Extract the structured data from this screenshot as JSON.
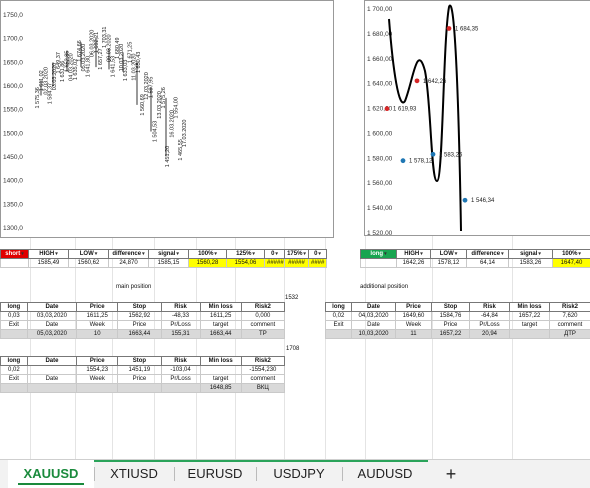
{
  "chart_left": {
    "y_ticks": [
      "1750,0",
      "1700,0",
      "1650,0",
      "1600,0",
      "1550,0",
      "1500,0",
      "1450,0",
      "1400,0",
      "1350,0",
      "1300,0"
    ],
    "y_values": [
      1750,
      1700,
      1650,
      1600,
      1550,
      1500,
      1450,
      1400,
      1350,
      1300
    ],
    "rotated_labels": [
      {
        "text": "1 575,36",
        "v": 1575
      },
      {
        "text": "1 611,02",
        "v": 1611
      },
      {
        "text": "02.03.2020",
        "v": 1611
      },
      {
        "text": "1 584,37",
        "v": 1584
      },
      {
        "text": "03.03.2020",
        "v": 1620
      },
      {
        "text": "1 649,37",
        "v": 1649
      },
      {
        "text": "1 631,86",
        "v": 1631
      },
      {
        "text": "1 652,85",
        "v": 1652
      },
      {
        "text": "04.03.2020",
        "v": 1640
      },
      {
        "text": "1 635,02",
        "v": 1635
      },
      {
        "text": "1 674,66",
        "v": 1674
      },
      {
        "text": "05.03.2020",
        "v": 1660
      },
      {
        "text": "1 641,80",
        "v": 1641
      },
      {
        "text": "06.03.2020",
        "v": 1690
      },
      {
        "text": "1 692,21",
        "v": 1692
      },
      {
        "text": "1 657,27",
        "v": 1657
      },
      {
        "text": "1 703,31",
        "v": 1703
      },
      {
        "text": "09.03.2020",
        "v": 1680
      },
      {
        "text": "1 641,53",
        "v": 1641
      },
      {
        "text": "1 680,49",
        "v": 1680
      },
      {
        "text": "10.03.2020",
        "v": 1660
      },
      {
        "text": "1 633,03",
        "v": 1633
      },
      {
        "text": "1 671,25",
        "v": 1671
      },
      {
        "text": "11.03.2020",
        "v": 1640
      },
      {
        "text": "1 650,43",
        "v": 1650
      },
      {
        "text": "1 560,69",
        "v": 1560
      },
      {
        "text": "12.03.2020",
        "v": 1600
      },
      {
        "text": "1 597,95",
        "v": 1597
      },
      {
        "text": "1 504,53",
        "v": 1504
      },
      {
        "text": "13.03.2020",
        "v": 1560
      },
      {
        "text": "1 575,26",
        "v": 1575
      },
      {
        "text": "1 451,20",
        "v": 1451
      },
      {
        "text": "16.03.2020",
        "v": 1520
      },
      {
        "text": "1 554,00",
        "v": 1554
      },
      {
        "text": "1 465,55",
        "v": 1465
      },
      {
        "text": "17.03.2020",
        "v": 1500
      }
    ]
  },
  "chart_right": {
    "y_ticks": [
      "1 700,00",
      "1 680,00",
      "1 660,00",
      "1 640,00",
      "1 620,00",
      "1 600,00",
      "1 580,00",
      "1 560,00",
      "1 540,00",
      "1 520,00"
    ],
    "y_values": [
      1700,
      1680,
      1660,
      1640,
      1620,
      1600,
      1580,
      1560,
      1540,
      1520
    ],
    "points": [
      {
        "label": "1 619,93",
        "y": 1619.93,
        "color": "#d62728"
      },
      {
        "label": "1 642,26",
        "y": 1642.26,
        "color": "#d62728"
      },
      {
        "label": "1 684,35",
        "y": 1684.35,
        "color": "#d62728"
      },
      {
        "label": "1 578,12",
        "y": 1578.12,
        "color": "#1f77b4"
      },
      {
        "label": "1 583,26",
        "y": 1583.26,
        "color": "#1f77b4"
      },
      {
        "label": "1 546,34",
        "y": 1546.34,
        "color": "#1f77b4"
      }
    ]
  },
  "left_block": {
    "header": {
      "c1": "short",
      "c2": "HIGH",
      "c3": "LOW",
      "c4": "difference",
      "c5": "signal",
      "c6": "100%",
      "c7": "125%",
      "c8": "0",
      "c9": "175%",
      "c10": "0"
    },
    "row": {
      "c2": "1585,49",
      "c3": "1560,62",
      "c4": "24,870",
      "c5": "1585,15",
      "c6": "1560,28",
      "c7": "1554,06",
      "c8": "#####",
      "c9": "#####",
      "c10": "####"
    },
    "main_position_label": "main position",
    "floating_value": "1532",
    "trade": {
      "hdr": [
        "long",
        "Date",
        "Price",
        "Stop",
        "Risk",
        "Min loss",
        "Risk2"
      ],
      "r1": [
        "0,03",
        "03,03,2020",
        "1611,25",
        "1562,92",
        "-48,33",
        "1611,25",
        "0,000"
      ],
      "r2": [
        "Exit",
        "Date",
        "Week",
        "Price",
        "Pr/Loss",
        "target",
        "comment"
      ],
      "r3": [
        "",
        "05,03,2020",
        "10",
        "1663,44",
        "155,31",
        "1663,44",
        "TP"
      ]
    },
    "floating_value2": "1708",
    "trade2": {
      "hdr": [
        "long",
        "Date",
        "Price",
        "Stop",
        "Risk",
        "Min loss",
        "Risk2"
      ],
      "r1": [
        "0,02",
        "",
        "1554,23",
        "1451,19",
        "-103,04",
        "",
        "-1554,230"
      ],
      "r2": [
        "Exit",
        "Date",
        "Week",
        "Price",
        "Pr/Loss",
        "target",
        "comment"
      ],
      "r3": [
        "",
        "",
        "",
        "",
        "",
        "1648,85",
        "ВКЦ"
      ]
    }
  },
  "right_block": {
    "header": {
      "c1": "long",
      "c2": "HIGH",
      "c3": "LOW",
      "c4": "difference",
      "c5": "signal",
      "c6": "100%"
    },
    "row": {
      "c2": "1642,26",
      "c3": "1578,12",
      "c4": "64,14",
      "c5": "1583,26",
      "c6": "1647,40"
    },
    "additional_position_label": "additional position",
    "trade": {
      "hdr": [
        "long",
        "Date",
        "Price",
        "Stop",
        "Risk",
        "Min loss",
        "Risk2"
      ],
      "r1": [
        "0,02",
        "04,03,2020",
        "1649,60",
        "1584,76",
        "-64,84",
        "1657,22",
        "7,620"
      ],
      "r2": [
        "Exit",
        "Date",
        "Week",
        "Price",
        "Pr/Loss",
        "target",
        "comment"
      ],
      "r3": [
        "",
        "10,03,2020",
        "11",
        "1657,22",
        "20,94",
        "",
        "ДТР"
      ]
    }
  },
  "tabs": [
    "XAUUSD",
    "XTIUSD",
    "EURUSD",
    "USDJPY",
    "AUDUSD",
    "+"
  ],
  "active_tab": "XAUUSD"
}
